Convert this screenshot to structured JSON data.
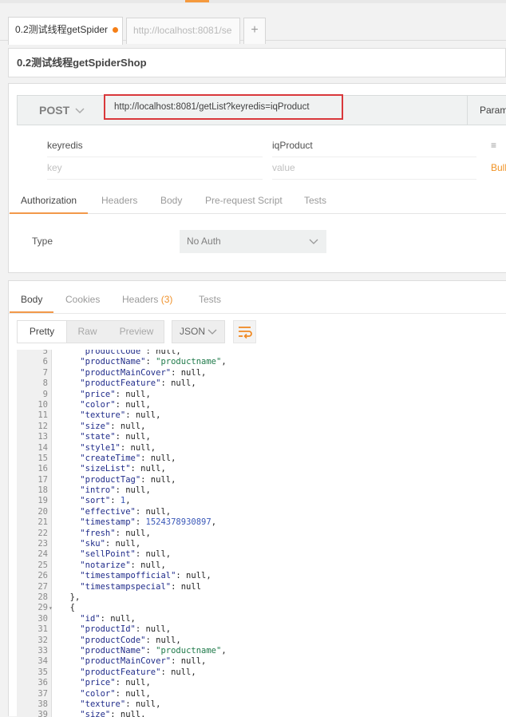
{
  "tabs": [
    {
      "label": "0.2测试线程getSpider",
      "unsaved": true,
      "active": true
    },
    {
      "label": "http://localhost:8081/se",
      "active": false
    }
  ],
  "new_tab_label": "+",
  "request": {
    "name": "0.2测试线程getSpiderShop",
    "method": "POST",
    "url": "http://localhost:8081/getList?keyredis=iqProduct",
    "params_label": "Param",
    "param_rows": [
      {
        "key": "keyredis",
        "value": "iqProduct"
      }
    ],
    "key_placeholder": "key",
    "value_placeholder": "value",
    "bulk_label": "Bulk",
    "row_menu_glyph": "≡"
  },
  "request_tabs": [
    "Authorization",
    "Headers",
    "Body",
    "Pre-request Script",
    "Tests"
  ],
  "auth": {
    "type_label": "Type",
    "type_value": "No Auth"
  },
  "response": {
    "tabs": [
      {
        "label": "Body"
      },
      {
        "label": "Cookies"
      },
      {
        "label": "Headers",
        "count": "(3)"
      },
      {
        "label": "Tests"
      }
    ],
    "view_modes": [
      "Pretty",
      "Raw",
      "Preview"
    ],
    "format": "JSON",
    "code_lines": [
      {
        "n": "5",
        "t": "    \"productCode\": null,"
      },
      {
        "n": "6",
        "t": "    \"productName\": \"productname\","
      },
      {
        "n": "7",
        "t": "    \"productMainCover\": null,"
      },
      {
        "n": "8",
        "t": "    \"productFeature\": null,"
      },
      {
        "n": "9",
        "t": "    \"price\": null,"
      },
      {
        "n": "10",
        "t": "    \"color\": null,"
      },
      {
        "n": "11",
        "t": "    \"texture\": null,"
      },
      {
        "n": "12",
        "t": "    \"size\": null,"
      },
      {
        "n": "13",
        "t": "    \"state\": null,"
      },
      {
        "n": "14",
        "t": "    \"style1\": null,"
      },
      {
        "n": "15",
        "t": "    \"createTime\": null,"
      },
      {
        "n": "16",
        "t": "    \"sizeList\": null,"
      },
      {
        "n": "17",
        "t": "    \"productTag\": null,"
      },
      {
        "n": "18",
        "t": "    \"intro\": null,"
      },
      {
        "n": "19",
        "t": "    \"sort\": 1,"
      },
      {
        "n": "20",
        "t": "    \"effective\": null,"
      },
      {
        "n": "21",
        "t": "    \"timestamp\": 1524378930897,"
      },
      {
        "n": "22",
        "t": "    \"fresh\": null,"
      },
      {
        "n": "23",
        "t": "    \"sku\": null,"
      },
      {
        "n": "24",
        "t": "    \"sellPoint\": null,"
      },
      {
        "n": "25",
        "t": "    \"notarize\": null,"
      },
      {
        "n": "26",
        "t": "    \"timestampofficial\": null,"
      },
      {
        "n": "27",
        "t": "    \"timestampspecial\": null"
      },
      {
        "n": "28",
        "t": "  },"
      },
      {
        "n": "29",
        "t": "  {",
        "fold": true
      },
      {
        "n": "30",
        "t": "    \"id\": null,"
      },
      {
        "n": "31",
        "t": "    \"productId\": null,"
      },
      {
        "n": "32",
        "t": "    \"productCode\": null,"
      },
      {
        "n": "33",
        "t": "    \"productName\": \"productname\","
      },
      {
        "n": "34",
        "t": "    \"productMainCover\": null,"
      },
      {
        "n": "35",
        "t": "    \"productFeature\": null,"
      },
      {
        "n": "36",
        "t": "    \"price\": null,"
      },
      {
        "n": "37",
        "t": "    \"color\": null,"
      },
      {
        "n": "38",
        "t": "    \"texture\": null,"
      },
      {
        "n": "39",
        "t": "    \"size\": null,"
      }
    ]
  },
  "colors": {
    "accent": "#f2994a",
    "highlight_box": "#d9383b",
    "unsaved_dot": "#f57f17"
  }
}
